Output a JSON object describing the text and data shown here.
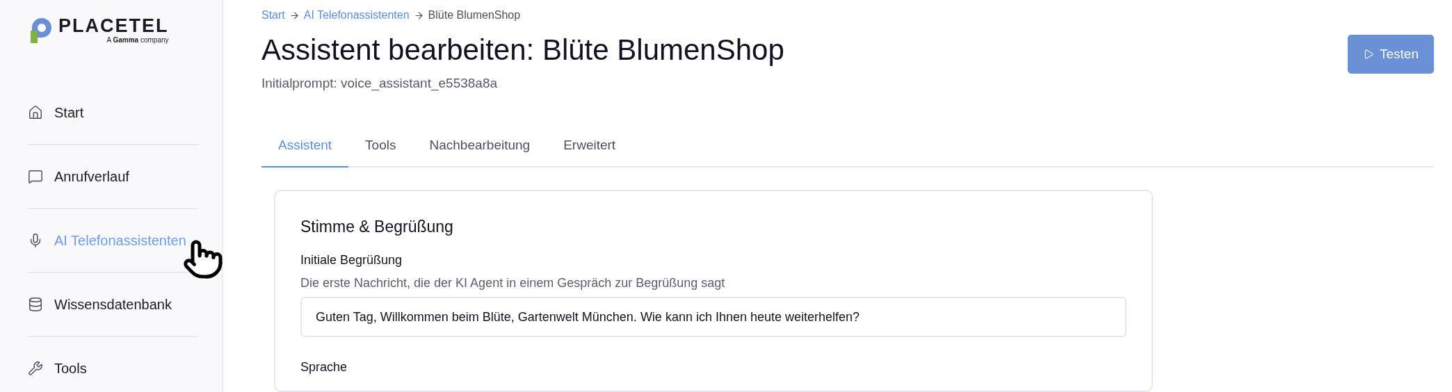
{
  "logo": {
    "name": "PLACETEL",
    "tagline": "A **Gamma** company"
  },
  "sidebar": {
    "items": [
      {
        "label": "Start",
        "selected": false
      },
      {
        "label": "Anrufverlauf",
        "selected": false
      },
      {
        "label": "AI Telefonassistenten",
        "selected": true
      },
      {
        "label": "Wissensdatenbank",
        "selected": false
      },
      {
        "label": "Tools",
        "selected": false
      }
    ]
  },
  "breadcrumb": [
    {
      "label": "Start",
      "kind": "link"
    },
    {
      "label": "AI Telefonassistenten",
      "kind": "link"
    },
    {
      "label": "Blüte BlumenShop",
      "kind": "current"
    }
  ],
  "title": "Assistent bearbeiten: Blüte BlumenShop",
  "subtitle": "Initialprompt: voice_assistant_e5538a8a",
  "test_button": {
    "label": "Testen"
  },
  "tabs": [
    {
      "label": "Assistent",
      "selected": true
    },
    {
      "label": "Tools",
      "selected": false
    },
    {
      "label": "Nachbearbeitung",
      "selected": false
    },
    {
      "label": "Erweitert",
      "selected": false
    }
  ],
  "card": {
    "title": "Stimme & Begrüßung",
    "fields": [
      {
        "label": "Initiale Begrüßung",
        "hint": "Die erste Nachricht, die der KI Agent in einem Gespräch zur Begrüßung sagt",
        "value": "Guten Tag, Willkommen beim Blüte, Gartenwelt München. Wie kann ich Ihnen heute weiterhelfen?"
      },
      {
        "label": "Sprache"
      }
    ]
  }
}
